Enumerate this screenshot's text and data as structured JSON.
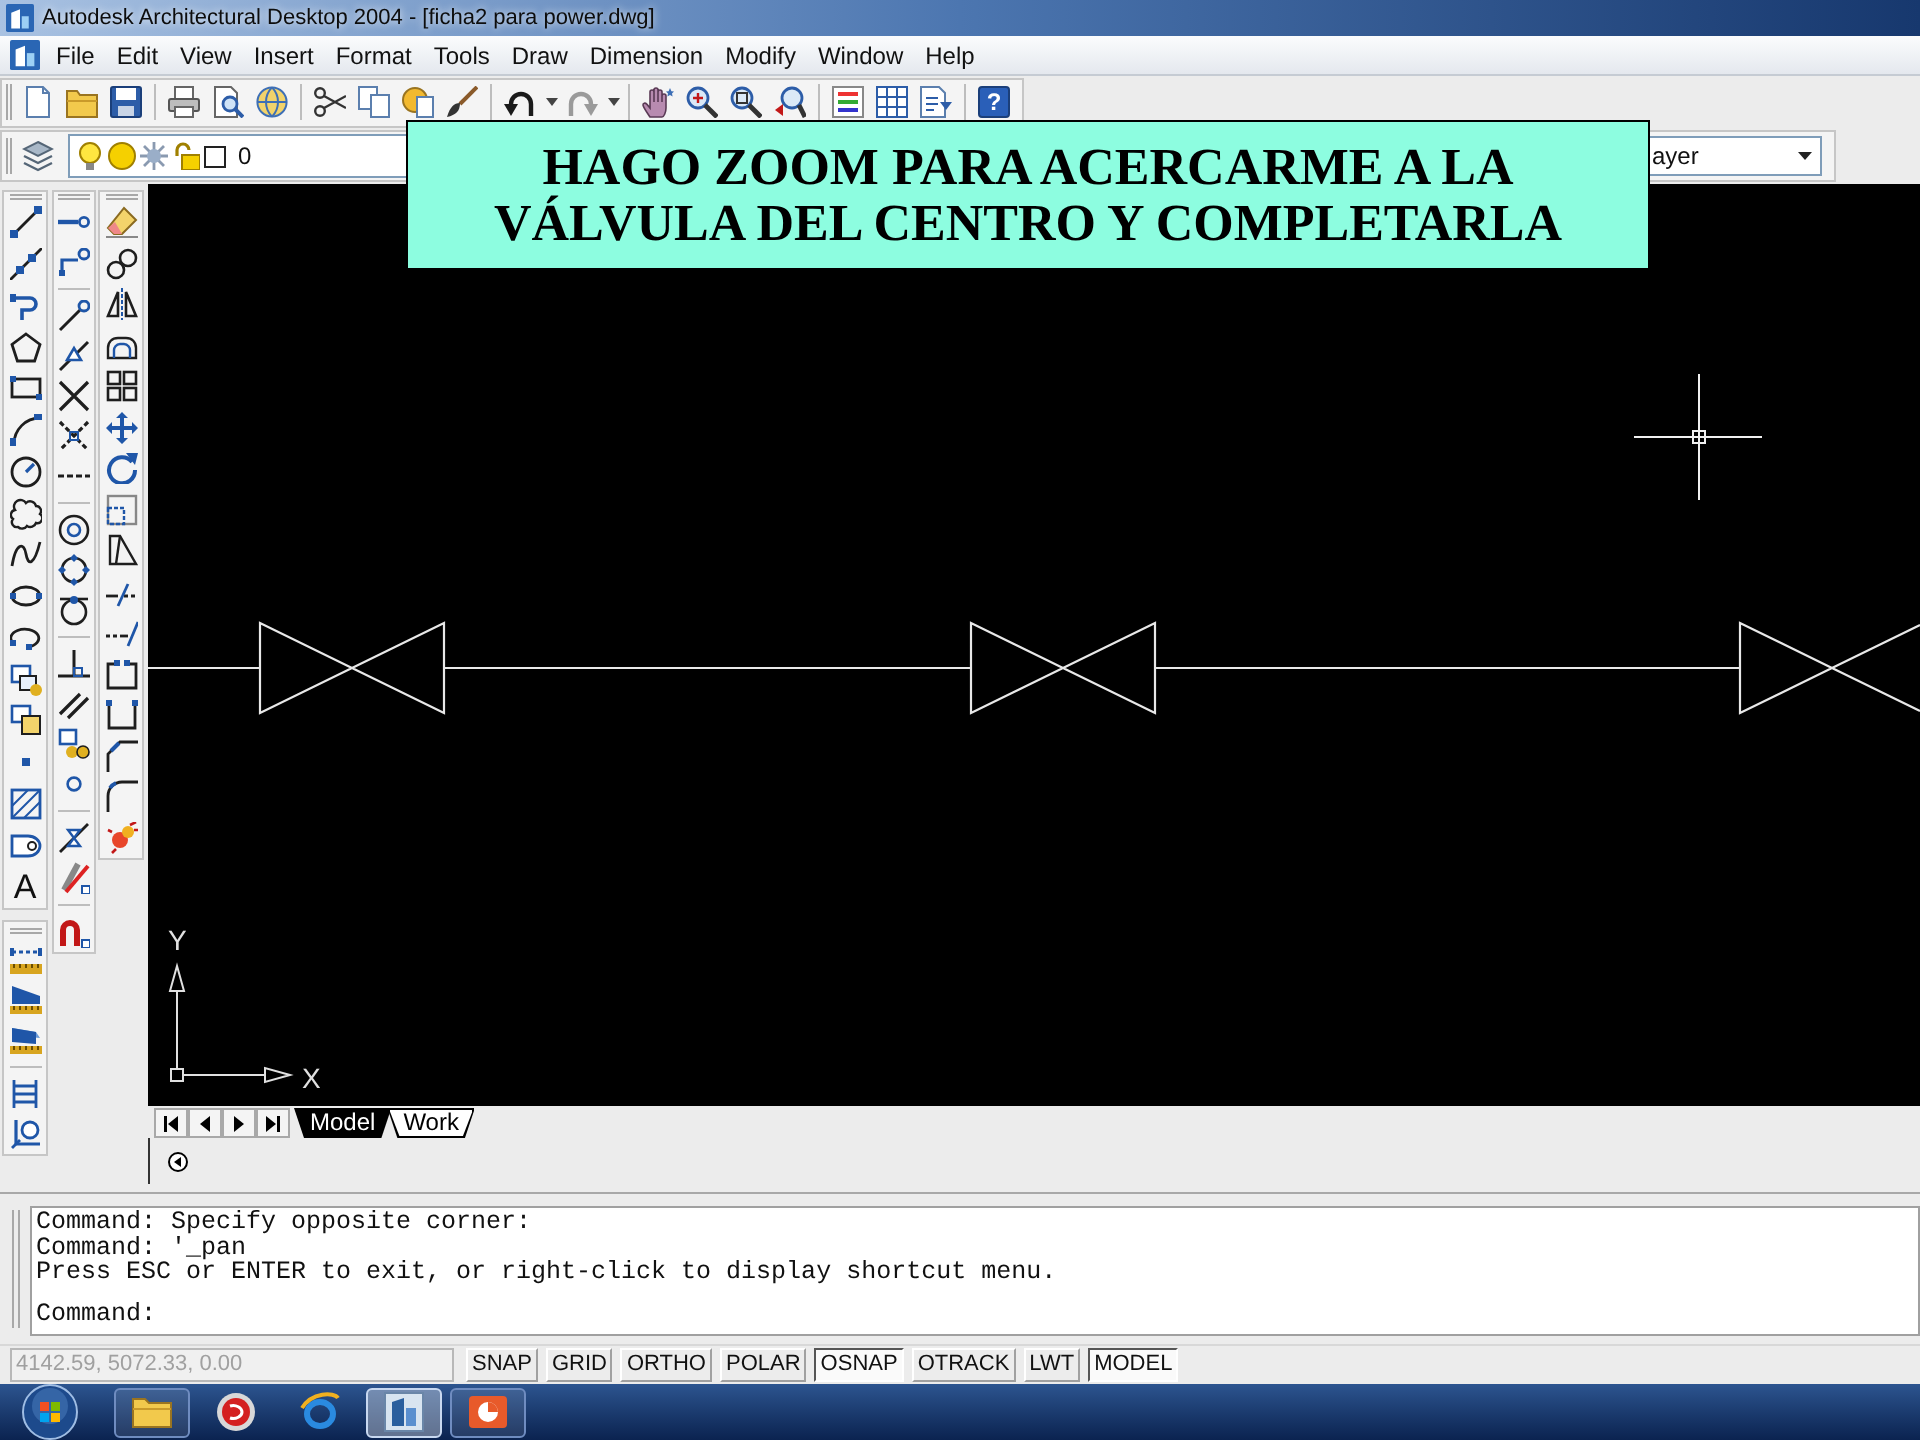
{
  "window": {
    "title": "Autodesk Architectural Desktop 2004 - [ficha2 para power.dwg]"
  },
  "menu_bar": [
    "File",
    "Edit",
    "View",
    "Insert",
    "Format",
    "Tools",
    "Draw",
    "Dimension",
    "Modify",
    "Window",
    "Help"
  ],
  "standard_toolbar": {
    "help_glyph": "?"
  },
  "layers_toolbar": {
    "current_layer": "0",
    "property_dropdown": "ayer"
  },
  "draw_toolbar": {
    "text_glyph": "A"
  },
  "callout": {
    "lines": [
      "HAGO ZOOM PARA ACERCARME A LA",
      "VÁLVULA DEL CENTRO Y COMPLETARLA"
    ]
  },
  "drawing": {
    "y_axis_label": "Y",
    "x_axis_label": "X"
  },
  "layout_tabs": [
    {
      "label": "Model",
      "selected": true
    },
    {
      "label": "Work",
      "selected": false
    }
  ],
  "command_window": {
    "history": [
      "Command: Specify opposite corner:",
      "Command: '_pan",
      "Press ESC or ENTER to exit, or right-click to display shortcut menu."
    ],
    "prompt": "Command:"
  },
  "status_bar": {
    "coordinates": {
      "value": "4142.59, 5072.33, 0.00",
      "disabled": true
    },
    "toggles": [
      {
        "label": "SNAP",
        "on": false
      },
      {
        "label": "GRID",
        "on": false
      },
      {
        "label": "ORTHO",
        "on": false
      },
      {
        "label": "POLAR",
        "on": false
      },
      {
        "label": "OSNAP",
        "on": true
      },
      {
        "label": "OTRACK",
        "on": false
      },
      {
        "label": "LWT",
        "on": false
      },
      {
        "label": "MODEL",
        "on": true
      }
    ]
  },
  "taskbar": [
    {
      "kind": "folder",
      "running": true,
      "selected": false
    },
    {
      "kind": "media",
      "running": false,
      "selected": false
    },
    {
      "kind": "browser",
      "running": false,
      "selected": false
    },
    {
      "kind": "cad",
      "running": true,
      "selected": true
    },
    {
      "kind": "slides",
      "running": true,
      "selected": false
    }
  ]
}
